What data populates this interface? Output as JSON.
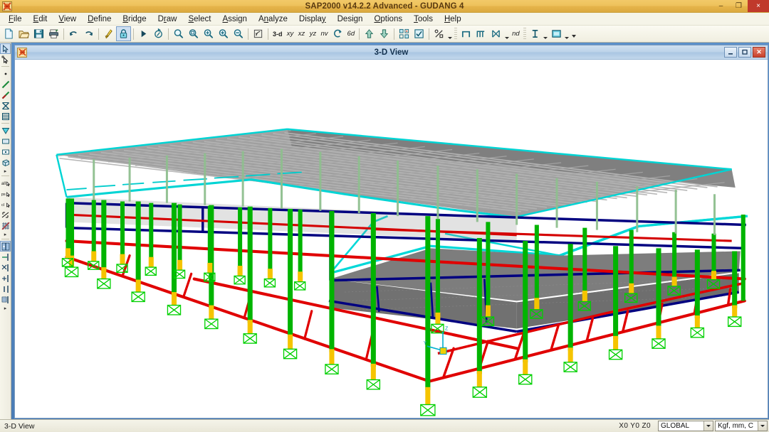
{
  "window": {
    "title": "SAP2000 v14.2.2 Advanced  - GUDANG 4",
    "app_icon": "sap2000-icon",
    "minimize_label": "–",
    "maximize_label": "❐",
    "close_label": "×"
  },
  "menu": {
    "items": [
      {
        "label": "File",
        "accel": "F"
      },
      {
        "label": "Edit",
        "accel": "E"
      },
      {
        "label": "View",
        "accel": "V"
      },
      {
        "label": "Define",
        "accel": "D"
      },
      {
        "label": "Bridge",
        "accel": "B"
      },
      {
        "label": "Draw",
        "accel": "r"
      },
      {
        "label": "Select",
        "accel": "S"
      },
      {
        "label": "Assign",
        "accel": "A"
      },
      {
        "label": "Analyze",
        "accel": "n"
      },
      {
        "label": "Display",
        "accel": "y"
      },
      {
        "label": "Design",
        "accel": "g"
      },
      {
        "label": "Options",
        "accel": "O"
      },
      {
        "label": "Tools",
        "accel": "T"
      },
      {
        "label": "Help",
        "accel": "H"
      }
    ]
  },
  "toolbar": {
    "buttons": [
      {
        "name": "new-model-icon",
        "tip": "New Model"
      },
      {
        "name": "open-file-icon",
        "tip": "Open File"
      },
      {
        "name": "save-icon",
        "tip": "Save"
      },
      {
        "name": "print-graphics-icon",
        "tip": "Print Graphics"
      },
      {
        "name": "undo-icon",
        "tip": "Undo"
      },
      {
        "name": "redo-icon",
        "tip": "Redo"
      },
      {
        "name": "refresh-window-icon",
        "tip": "Refresh Window"
      },
      {
        "name": "lock-unlock-model-icon",
        "tip": "Lock/Unlock Model",
        "pressed": true
      },
      {
        "name": "run-analysis-icon",
        "tip": "Run Analysis"
      },
      {
        "name": "run-design-icon",
        "tip": "Run Design"
      },
      {
        "name": "rubber-band-zoom-icon",
        "tip": "Rubber Band Zoom"
      },
      {
        "name": "restore-full-view-icon",
        "tip": "Restore Full View"
      },
      {
        "name": "previous-zoom-icon",
        "tip": "Previous Zoom"
      },
      {
        "name": "zoom-in-one-step-icon",
        "tip": "Zoom In One Step"
      },
      {
        "name": "zoom-out-one-step-icon",
        "tip": "Zoom Out One Step"
      },
      {
        "name": "pan-icon",
        "tip": "Pan"
      }
    ],
    "view_labels": [
      {
        "name": "view-3d-label",
        "label": "3-d"
      },
      {
        "name": "view-xy-label",
        "label": "xy"
      },
      {
        "name": "view-xz-label",
        "label": "xz"
      },
      {
        "name": "view-yz-label",
        "label": "yz"
      },
      {
        "name": "view-nv-label",
        "label": "nv"
      }
    ],
    "rotate_buttons": [
      {
        "name": "perspective-toggle-icon",
        "tip": "Set Perspective"
      },
      {
        "name": "rotate-3d-view-icon",
        "label": "6d",
        "tip": "Rotate 3D View"
      }
    ],
    "nav_buttons": [
      {
        "name": "move-up-in-list-icon",
        "tip": "Move Up In List"
      },
      {
        "name": "move-down-in-list-icon",
        "tip": "Move Down In List"
      }
    ],
    "display_buttons": [
      {
        "name": "set-display-options-icon",
        "tip": "Set Display Options"
      },
      {
        "name": "show-undeformed-shape-icon",
        "tip": "Show Undeformed Shape"
      },
      {
        "name": "assign-loads-icon",
        "tip": "Assign Loads"
      }
    ],
    "frame_buttons": [
      {
        "name": "draw-frame-icon",
        "tip": "Draw Frame/Cable"
      },
      {
        "name": "draw-section-icon",
        "tip": "Quick Draw Frame"
      },
      {
        "name": "draw-brace-icon",
        "tip": "Quick Draw Braces"
      },
      {
        "name": "nd-label",
        "label": "nd"
      }
    ],
    "text_buttons": [
      {
        "name": "show-text-icon",
        "tip": "Show Text"
      },
      {
        "name": "display-view-icon",
        "tip": "Display Options"
      }
    ]
  },
  "left_toolbar": {
    "buttons": [
      {
        "name": "pointer-select-icon",
        "tip": "Set Select Mode",
        "pressed": true
      },
      {
        "name": "reshape-element-icon",
        "tip": "Reshape Element"
      },
      {
        "name": "draw-point-icon",
        "tip": "Draw Special Joint"
      },
      {
        "name": "draw-frame-cable-icon",
        "tip": "Draw Frame/Cable Element"
      },
      {
        "name": "quick-draw-frame-icon",
        "tip": "Quick Draw Frame/Cable"
      },
      {
        "name": "quick-draw-brace-icon",
        "tip": "Quick Draw Braces"
      },
      {
        "name": "quick-draw-secondary-icon",
        "tip": "Quick Draw Secondary Beams"
      },
      {
        "name": "draw-poly-area-icon",
        "tip": "Draw Poly Area"
      },
      {
        "name": "draw-rect-area-icon",
        "tip": "Draw Rectangular Area"
      },
      {
        "name": "quick-draw-area-icon",
        "tip": "Quick Draw Area"
      },
      {
        "name": "draw-solid-icon",
        "tip": "Draw Solid"
      },
      {
        "name": "select-all-icon",
        "tip": "Select All"
      },
      {
        "name": "get-previous-selection-icon",
        "tip": "Get Previous Selection"
      },
      {
        "name": "clear-selection-icon",
        "tip": "Clear Selection"
      },
      {
        "name": "select-using-intersecting-line-icon",
        "tip": "Select Using Intersecting Line"
      },
      {
        "name": "snap-to-point-icon",
        "tip": "Snap to Joints and Grid Points"
      },
      {
        "name": "snap-to-midpoint-icon",
        "tip": "Snap to Midpoints and Ends",
        "pressed": true
      },
      {
        "name": "snap-to-element-intersection-icon",
        "tip": "Snap to Element Intersections"
      },
      {
        "name": "snap-perpendicular-icon",
        "tip": "Snap to Perpendicular"
      },
      {
        "name": "snap-to-line-icon",
        "tip": "Snap to Lines and Edges"
      },
      {
        "name": "snap-to-fine-grid-icon",
        "tip": "Snap to Fine Grid"
      }
    ]
  },
  "mdi": {
    "title": "3-D View",
    "icon": "sap2000-icon",
    "minimize_label": "–",
    "restore_label": "❐",
    "close_label": "✕"
  },
  "statusbar": {
    "view_label": "3-D View",
    "coordinates": "X0  Y0  Z0",
    "coord_system": "GLOBAL",
    "units": "Kgf, mm, C"
  },
  "model": {
    "name": "GUDANG 4",
    "view_type": "3-D View",
    "axis_triad": {
      "x": "X",
      "y": "Y",
      "z": "Z"
    },
    "colors": {
      "column": "#00b400",
      "column_base": "#f0c000",
      "ground_beam": "#e00000",
      "mid_beam": "#000080",
      "roof_member": "#00d0d0",
      "purlin": "#9a9a9a",
      "panel": "#7d7d7d",
      "support": "#00d000",
      "background": "#ffffff"
    },
    "description": "Steel warehouse frame: 2 bays of portal frames with green columns, red ground-level beam grid, navy mid-level beams, cyan roof trusses/rafters and gray purlin deck, pinned base supports."
  }
}
